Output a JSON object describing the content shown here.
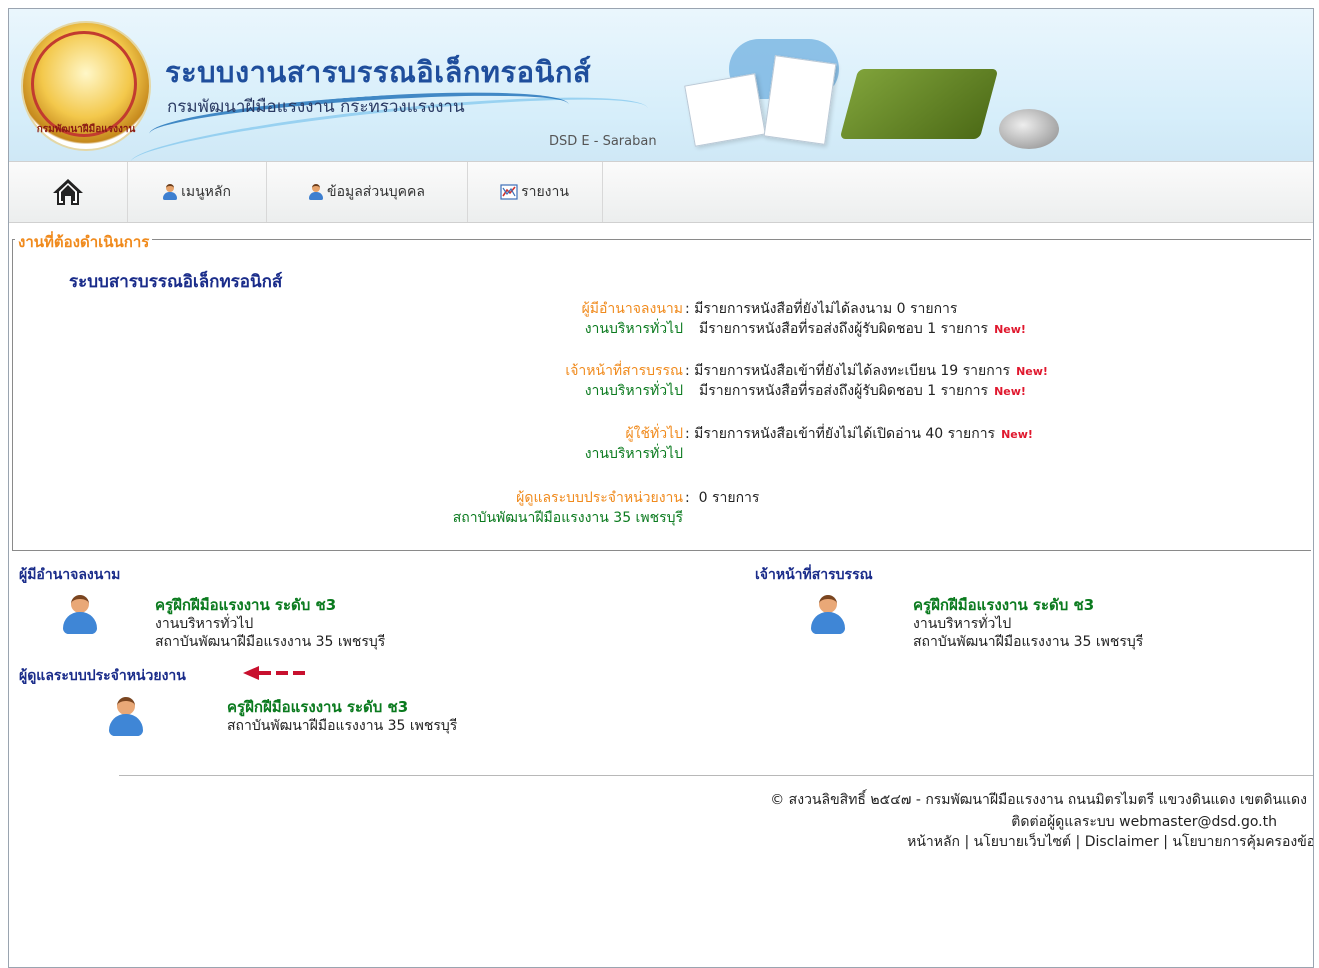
{
  "header": {
    "title": "ระบบงานสารบรรณอิเล็กทรอนิกส์",
    "subtitle": "กรมพัฒนาฝีมือแรงงาน กระทรวงแรงงาน",
    "tag": "DSD E - Saraban",
    "logo_text": "กรมพัฒนาฝีมือแรงงาน"
  },
  "nav": {
    "home_icon": "home-icon",
    "items": [
      {
        "label": "เมนูหลัก",
        "icon": "user-icon"
      },
      {
        "label": "ข้อมูลส่วนบุคคล",
        "icon": "user-icon"
      },
      {
        "label": "รายงาน",
        "icon": "report-chart-icon"
      }
    ]
  },
  "tasks": {
    "legend": "งานที่ต้องดำเนินการ",
    "system_title": "ระบบสารบรรณอิเล็กทรอนิกส์",
    "new_badge": "New!",
    "groups": [
      {
        "role": "ผู้มีอำนาจลงนาม",
        "unit": "งานบริหารทั่วไป",
        "line1": "มีรายการหนังสือที่ยังไม่ได้ลงนาม 0 รายการ",
        "line2": "มีรายการหนังสือที่รอส่งถึงผู้รับผิดชอบ 1 รายการ"
      },
      {
        "role": "เจ้าหน้าที่สารบรรณ",
        "unit": "งานบริหารทั่วไป",
        "line1": "มีรายการหนังสือเข้าที่ยังไม่ได้ลงทะเบียน 19 รายการ",
        "line2": "มีรายการหนังสือที่รอส่งถึงผู้รับผิดชอบ 1 รายการ"
      },
      {
        "role": "ผู้ใช้ทั่วไป",
        "unit": "งานบริหารทั่วไป",
        "line1": "มีรายการหนังสือเข้าที่ยังไม่ได้เปิดอ่าน 40 รายการ"
      },
      {
        "role": "ผู้ดูแลระบบประจำหน่วยงาน",
        "unit": "สถาบันพัฒนาฝีมือแรงงาน 35 เพชรบุรี",
        "line1": "0 รายการ"
      }
    ]
  },
  "people": {
    "signer": {
      "heading": "ผู้มีอำนาจลงนาม",
      "name": "ครูฝึกฝีมือแรงงาน ระดับ ช3",
      "dept": "งานบริหารทั่วไป",
      "org": "สถาบันพัฒนาฝีมือแรงงาน 35 เพชรบุรี"
    },
    "clerk": {
      "heading": "เจ้าหน้าที่สารบรรณ",
      "name": "ครูฝึกฝีมือแรงงาน ระดับ ช3",
      "dept": "งานบริหารทั่วไป",
      "org": "สถาบันพัฒนาฝีมือแรงงาน 35 เพชรบุรี"
    },
    "admin": {
      "heading": "ผู้ดูแลระบบประจำหน่วยงาน",
      "name": "ครูฝึกฝีมือแรงงาน ระดับ ช3",
      "org": "สถาบันพัฒนาฝีมือแรงงาน 35 เพชรบุรี"
    }
  },
  "footer": {
    "copyright": "© สงวนลิขสิทธิ์ ๒๕๔๗ - กรมพัฒนาฝีมือแรงงาน ถนนมิตรไมตรี แขวงดินแดง เขตดินแดง",
    "contact": "ติดต่อผู้ดูแลระบบ webmaster@dsd.go.th",
    "links": [
      "หน้าหลัก",
      "นโยบายเว็บไซต์",
      "Disclaimer",
      "นโยบายการคุ้มครองข้อมูล"
    ],
    "separator": "|"
  },
  "colors": {
    "title_blue": "#1f4e9c",
    "legend_orange": "#f08a1c",
    "unit_green": "#0a7a1e",
    "new_red": "#e0182e",
    "arrow_red": "#c8102e"
  }
}
